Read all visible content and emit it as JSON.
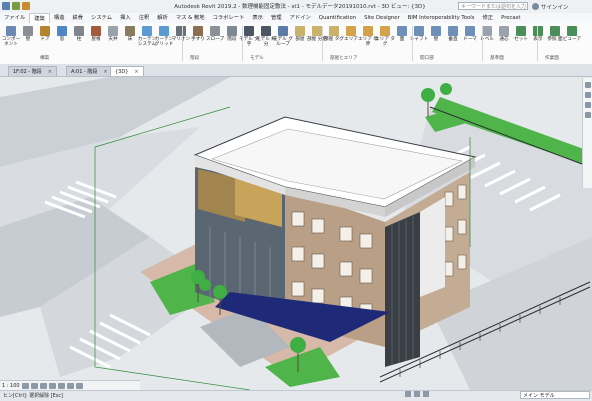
{
  "app": {
    "title": "Autodesk Revit 2019.2 - 数理機能固定敷法 - st1 - モデルデータ20191010.rvt - 3D ビュー: {3D}",
    "search_placeholder": "キーワードまたは語句を入力",
    "user_label": "サインイン"
  },
  "menu": [
    "ファイル",
    "建築",
    "構造",
    "鉄骨",
    "システム",
    "挿入",
    "注釈",
    "解析",
    "マス & 敷地",
    "コラボレート",
    "表示",
    "管理",
    "アドイン",
    "Quantification",
    "Site Designer",
    "BIM Interoperability Tools",
    "修正",
    "Precast"
  ],
  "ribbon": {
    "tools": [
      {
        "label": "コンポーネント",
        "color": "#6b87b4"
      },
      {
        "label": "壁",
        "color": "#8a8f96"
      },
      {
        "label": "ドア",
        "color": "#b7822e"
      },
      {
        "label": "窓",
        "color": "#4f86c6"
      },
      {
        "label": "柱",
        "color": "#7e858c"
      },
      {
        "label": "屋根",
        "color": "#a45a3d"
      },
      {
        "label": "天井",
        "color": "#9aa3ad"
      },
      {
        "label": "床",
        "color": "#8a7a5e"
      },
      {
        "label": "カーテン システム",
        "color": "#5b9bd1"
      },
      {
        "label": "カーテン グリッド",
        "color": "#5b9bd1"
      },
      {
        "label": "マリオン",
        "color": "#6a7078"
      },
      {
        "label": "手すり",
        "color": "#8a6e4f"
      },
      {
        "label": "スロープ",
        "color": "#8c9197"
      },
      {
        "label": "階段",
        "color": "#7d8893"
      },
      {
        "label": "モデル 文字",
        "color": "#4b5563"
      },
      {
        "label": "モデル 線分",
        "color": "#4b5563"
      },
      {
        "label": "モデル グループ",
        "color": "#5c7ca8"
      },
      {
        "label": "部屋",
        "color": "#c9b26a"
      },
      {
        "label": "部屋 分割",
        "color": "#c9b26a"
      },
      {
        "label": "部屋 タグ",
        "color": "#c9b26a"
      },
      {
        "label": "エリア",
        "color": "#d3a24a"
      },
      {
        "label": "エリア 境界",
        "color": "#d3a24a"
      },
      {
        "label": "エリア タグ",
        "color": "#d3a24a"
      },
      {
        "label": "面",
        "color": "#6e8fb7"
      },
      {
        "label": "シャフト",
        "color": "#6e8fb7"
      },
      {
        "label": "壁",
        "color": "#6e8fb7"
      },
      {
        "label": "垂直",
        "color": "#6e8fb7"
      },
      {
        "label": "ドーマ",
        "color": "#6e8fb7"
      },
      {
        "label": "レベル",
        "color": "#9aa3ad"
      },
      {
        "label": "通芯",
        "color": "#9aa3ad"
      },
      {
        "label": "セット",
        "color": "#4a8f5a"
      },
      {
        "label": "表示",
        "color": "#4a8f5a"
      },
      {
        "label": "参照 面",
        "color": "#4a8f5a"
      },
      {
        "label": "ビューア",
        "color": "#4a8f5a"
      }
    ],
    "panels": [
      "構築",
      "階段",
      "モデル",
      "部屋とエリア",
      "開口部",
      "基準面",
      "作業面"
    ]
  },
  "tabs": [
    {
      "label": "1F:02 - 階段",
      "active": false
    },
    {
      "label": "A:01 - 階段",
      "active": false
    },
    {
      "label": "{3D}",
      "active": true
    }
  ],
  "status": {
    "text": "ヒン[Ctrl]: 選択解除 [Esc]",
    "scale": "1 : 100",
    "selection_box": "メイン モデル",
    "count": ":0"
  },
  "colors": {
    "ribbon_bg": "#fbfbfc",
    "lawn": "#4fb44a",
    "facade_tan": "#b89f86",
    "roof": "#ffffff",
    "glass": "#5a6672",
    "canopy": "#1e2a78",
    "fin": "#3a3f45",
    "terrace": "#c9a08c"
  }
}
